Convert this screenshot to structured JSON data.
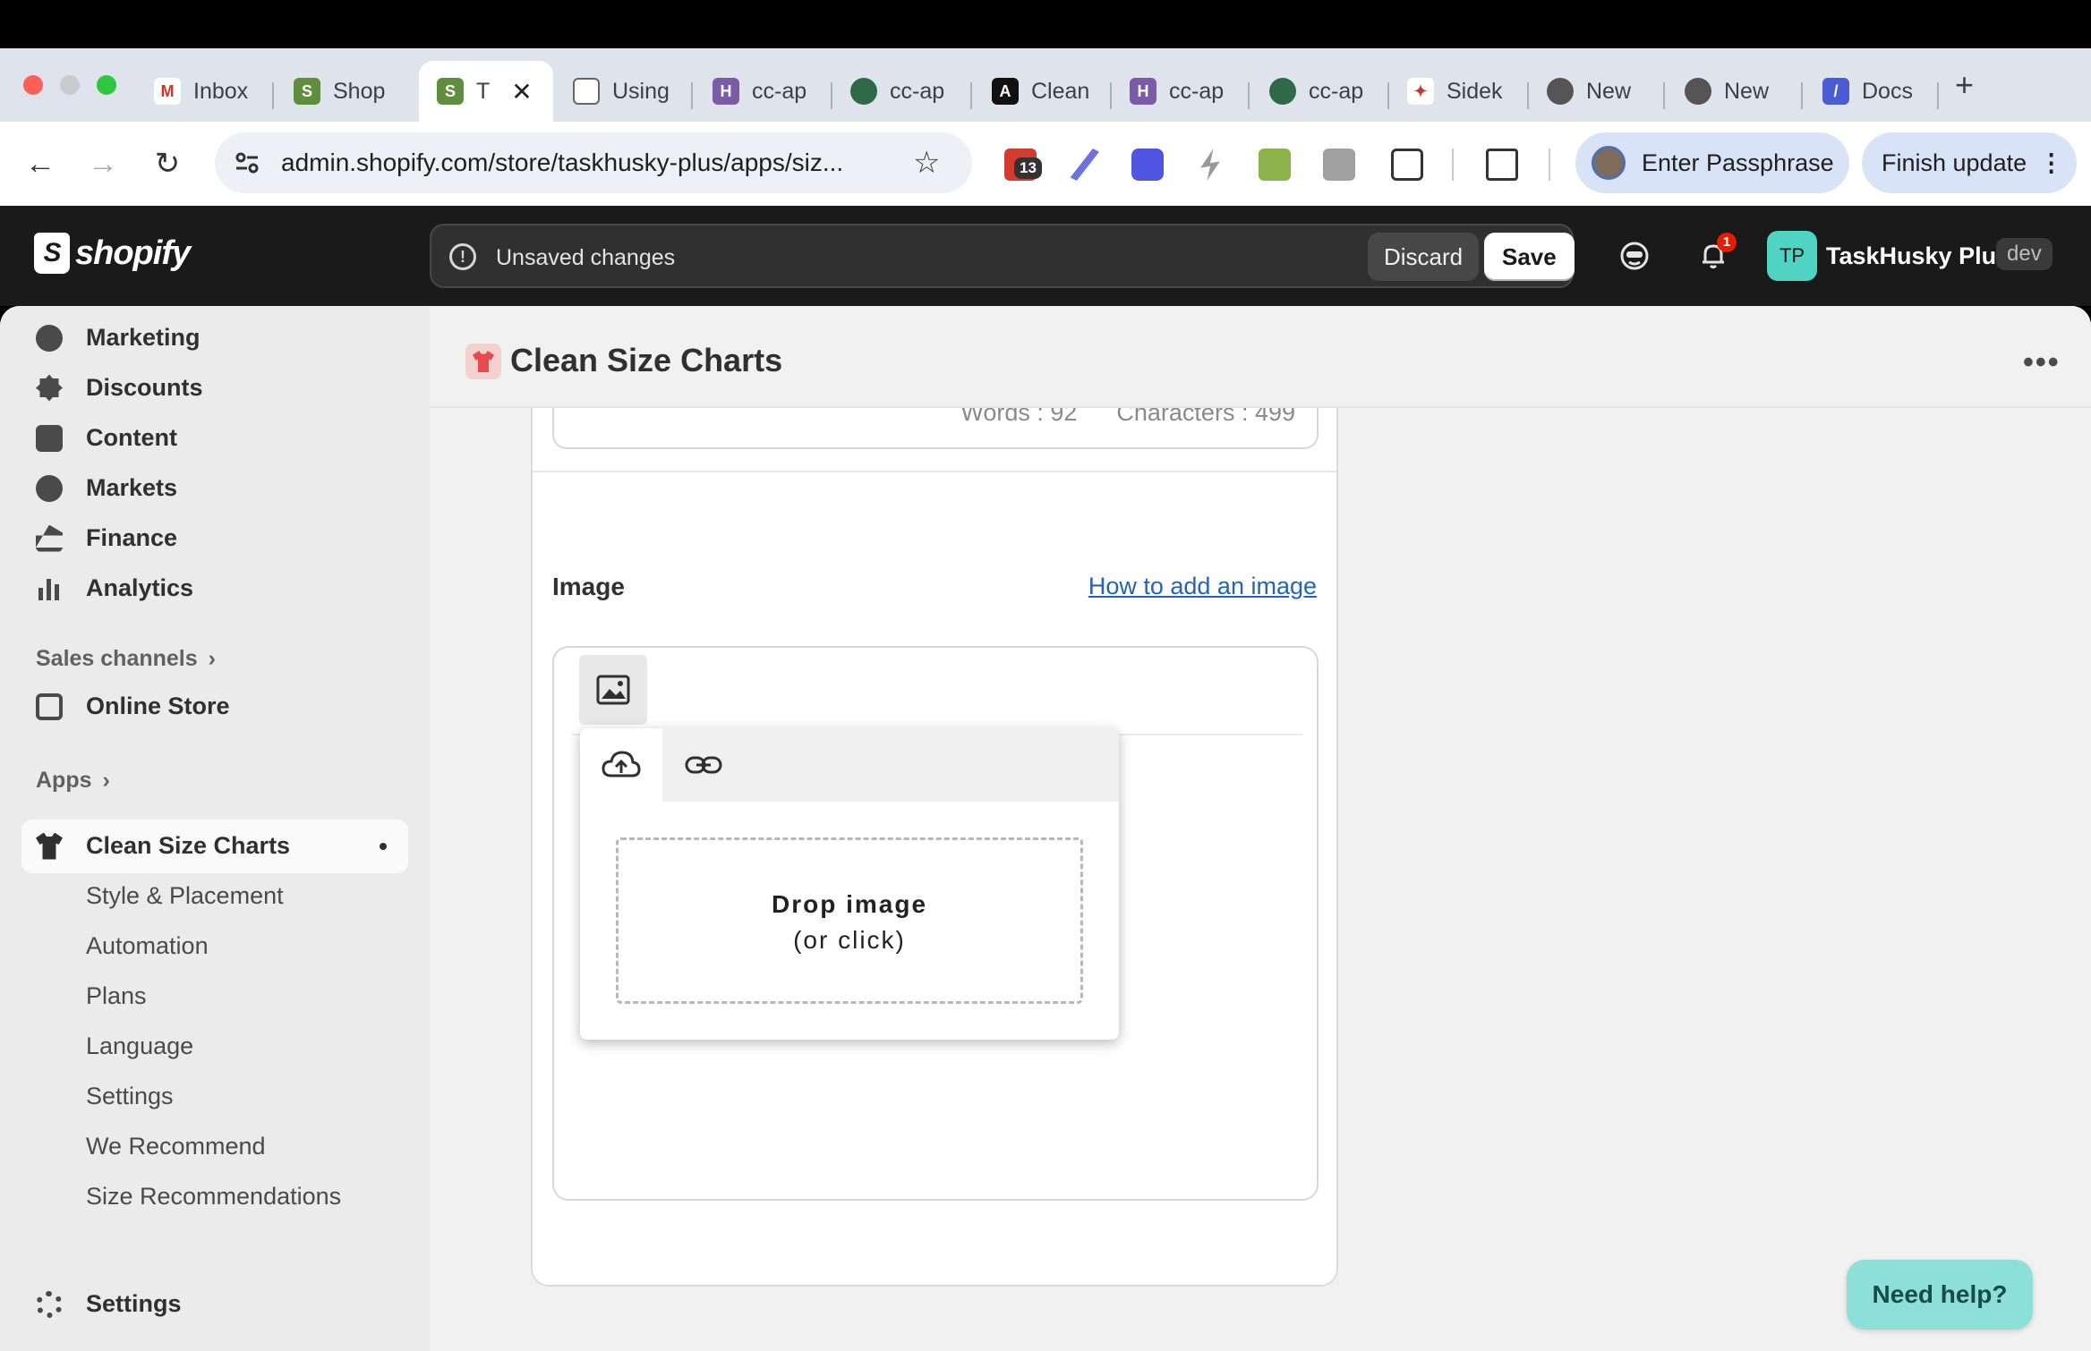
{
  "browser": {
    "tabs": [
      {
        "label": "Inbox",
        "icon": "gmail-icon"
      },
      {
        "label": "Shop",
        "icon": "shopify-icon"
      },
      {
        "label": "T",
        "icon": "shopify-icon",
        "active": true
      },
      {
        "label": "Using",
        "icon": "document-icon"
      },
      {
        "label": "cc-ap",
        "icon": "heroku-icon"
      },
      {
        "label": "cc-ap",
        "icon": "mascot-icon"
      },
      {
        "label": "Clean",
        "icon": "clean-icon"
      },
      {
        "label": "cc-ap",
        "icon": "heroku-icon"
      },
      {
        "label": "cc-ap",
        "icon": "mascot-icon"
      },
      {
        "label": "Sidek",
        "icon": "sidekick-icon"
      },
      {
        "label": "New",
        "icon": "chrome-icon"
      },
      {
        "label": "New",
        "icon": "chrome-icon"
      },
      {
        "label": "Docs",
        "icon": "docs-icon"
      }
    ],
    "new_tab": "+",
    "tab_close": "✕",
    "url": "admin.shopify.com/store/taskhusky-plus/apps/siz...",
    "extension_badge": "13",
    "passphrase_button": "Enter Passphrase",
    "finish_update_button": "Finish update"
  },
  "shopify_header": {
    "logo_text": "shopify",
    "unsaved_message": "Unsaved changes",
    "discard_label": "Discard",
    "save_label": "Save",
    "notification_count": "1",
    "store_initials": "TP",
    "store_name": "TaskHusky Plus",
    "store_badge": "dev"
  },
  "sidebar": {
    "items": [
      {
        "label": "Marketing",
        "icon": "marketing-icon"
      },
      {
        "label": "Discounts",
        "icon": "discount-icon"
      },
      {
        "label": "Content",
        "icon": "content-icon"
      },
      {
        "label": "Markets",
        "icon": "globe-icon"
      },
      {
        "label": "Finance",
        "icon": "bank-icon"
      },
      {
        "label": "Analytics",
        "icon": "bar-chart-icon"
      }
    ],
    "sales_channels_label": "Sales channels",
    "online_store_label": "Online Store",
    "apps_label": "Apps",
    "active_app": "Clean Size Charts",
    "sub_items": [
      "Style & Placement",
      "Automation",
      "Plans",
      "Language",
      "Settings",
      "We Recommend",
      "Size Recommendations"
    ],
    "settings_label": "Settings"
  },
  "page": {
    "title": "Clean Size Charts",
    "words": "Words : 92",
    "characters": "Characters : 499",
    "image_section_label": "Image",
    "how_to_link": "How to add an image",
    "drop_title": "Drop image",
    "drop_sub": "(or click)"
  },
  "help_button": "Need help?",
  "colors": {
    "accent_link": "#2463bc",
    "help_button_bg": "#8de0d8",
    "store_avatar": "#4fd4c4",
    "notification": "#e51c00"
  }
}
